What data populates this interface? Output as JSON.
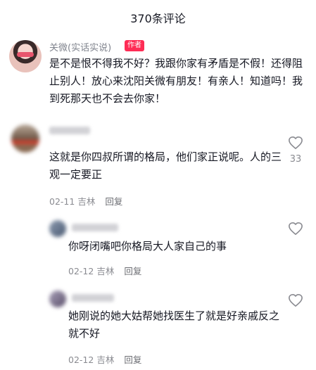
{
  "header": {
    "title": "370条评论"
  },
  "main_comment": {
    "author": "关微(实话实说)",
    "badge": "作者",
    "text": "是不是恨不得我不好？我跟你家有矛盾是不假！还得阻止别人！放心来沈阳关微有朋友！有亲人！知道吗！我到死那天也不会去你家！"
  },
  "comment1": {
    "text": "这就是你四叔所谓的格局，他们家正说呢。人的三观一定要正",
    "date": "02-11",
    "location": "吉林",
    "reply_label": "回复",
    "likes": "33"
  },
  "reply1": {
    "text": "你呀闭嘴吧你格局大人家自己的事",
    "date": "02-12",
    "location": "吉林",
    "reply_label": "回复"
  },
  "reply2": {
    "text": "她刚说的她大姑帮她找医生了就是好亲戚反之就不好",
    "date": "02-12",
    "location": "吉林",
    "reply_label": "回复"
  },
  "icons": {
    "like": "heart-outline-icon"
  }
}
